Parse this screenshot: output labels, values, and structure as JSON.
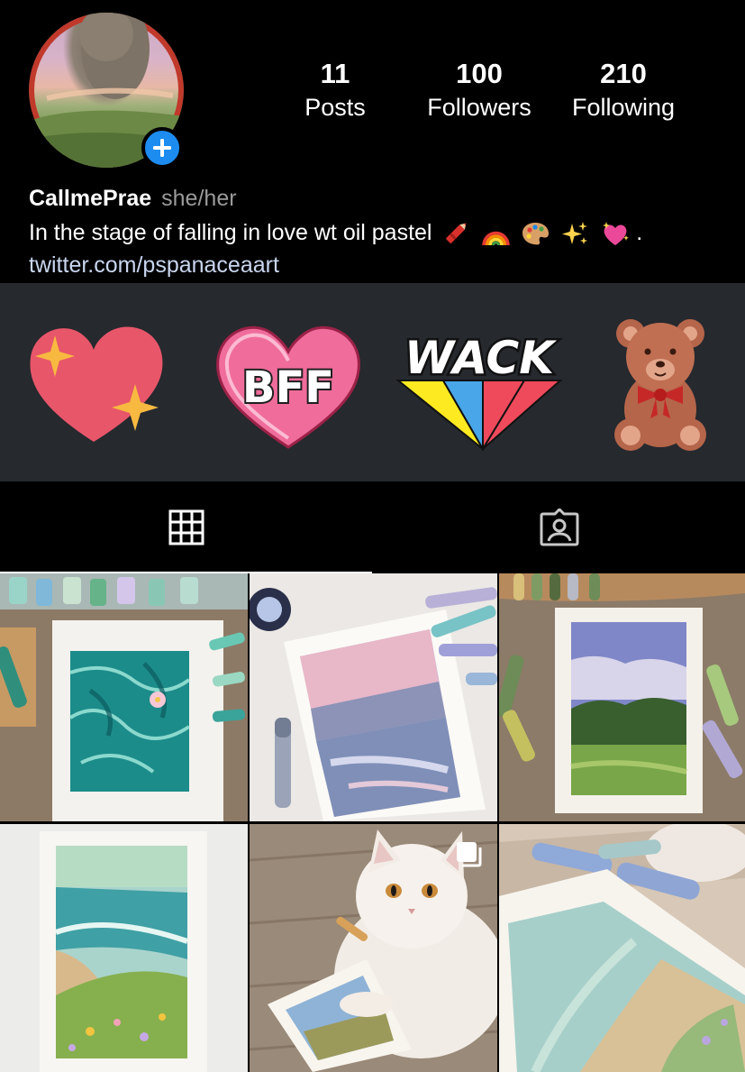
{
  "profile": {
    "username": "CallmePrae",
    "pronouns": "she/her",
    "bio": "In the stage of falling in love wt oil pastel",
    "bio_end": ".",
    "link": "twitter.com/pspanaceaart"
  },
  "stats": [
    {
      "value": "11",
      "label": "Posts"
    },
    {
      "value": "100",
      "label": "Followers"
    },
    {
      "value": "210",
      "label": "Following"
    }
  ],
  "bio_emoji_icons": [
    "crayon-icon",
    "rainbow-icon",
    "palette-icon",
    "sparkles-icon",
    "sparkling-heart-icon"
  ],
  "stickers": [
    {
      "name": "sparkle-heart-sticker"
    },
    {
      "name": "bff-heart-sticker",
      "text": "BFF"
    },
    {
      "name": "wack-sticker",
      "text": "WACK"
    },
    {
      "name": "teddy-bear-sticker"
    }
  ],
  "tabs": [
    {
      "name": "grid-tab",
      "icon": "grid-icon",
      "active": true
    },
    {
      "name": "tagged-tab",
      "icon": "tagged-person-icon",
      "active": false
    }
  ],
  "posts": [
    {
      "name": "post-water-painting"
    },
    {
      "name": "post-pink-sky-painting"
    },
    {
      "name": "post-green-field-painting"
    },
    {
      "name": "post-beach-painting"
    },
    {
      "name": "post-cat-photo",
      "multi": true
    },
    {
      "name": "post-beach-close-up"
    }
  ],
  "colors": {
    "background": "#000000",
    "sticker_panel": "#26292e",
    "accent_blue": "#1d8cf0",
    "link": "#c9d6ef",
    "muted_text": "#9a9a9a"
  }
}
